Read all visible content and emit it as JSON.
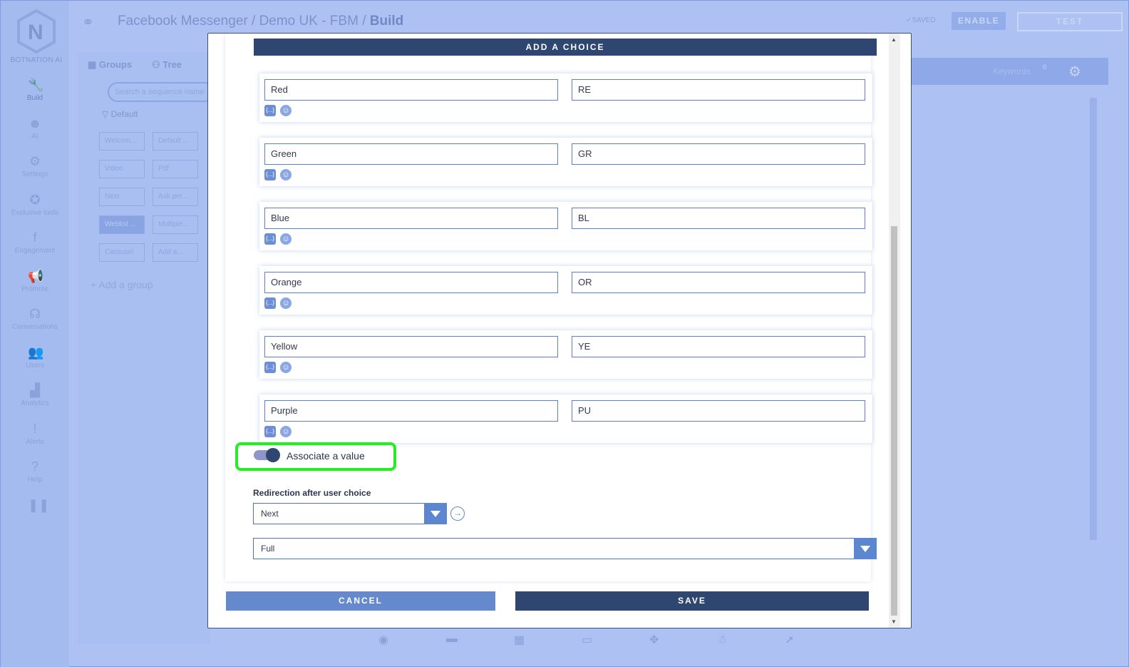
{
  "app": {
    "logo_text": "BOTNATION AI",
    "breadcrumb": [
      "Facebook Messenger",
      "Demo UK - FBM",
      "Build"
    ],
    "breadcrumb_sep": " / ",
    "saved": "SAVED",
    "enable_label": "ENABLE",
    "test_label": "TEST"
  },
  "sidebar": {
    "items": [
      {
        "label": "Build",
        "icon": "wrench-icon",
        "glyph": "🔧",
        "active": true
      },
      {
        "label": "AI",
        "icon": "robot-icon",
        "glyph": "☻"
      },
      {
        "label": "Settings",
        "icon": "gear-icon",
        "glyph": "⚙"
      },
      {
        "label": "Exclusive tools",
        "icon": "star-icon",
        "glyph": "✪"
      },
      {
        "label": "Engagement",
        "icon": "facebook-icon",
        "glyph": "f"
      },
      {
        "label": "Promote",
        "icon": "megaphone-icon",
        "glyph": "📢"
      },
      {
        "label": "Conversations",
        "icon": "headset-icon",
        "glyph": "☊"
      },
      {
        "label": "Users",
        "icon": "users-icon",
        "glyph": "👥"
      },
      {
        "label": "Analytics",
        "icon": "chart-icon",
        "glyph": "▟"
      },
      {
        "label": "Alerts",
        "icon": "alert-icon",
        "glyph": "!"
      },
      {
        "label": "Help",
        "icon": "help-icon",
        "glyph": "?"
      }
    ]
  },
  "panel": {
    "tabs": [
      "Groups",
      "Tree"
    ],
    "search_placeholder": "Search a sequence name",
    "group_name": "Default",
    "chips": [
      "Welcom...",
      "Default ...",
      "Video",
      "Pdf",
      "Next",
      "Ask pet ...",
      "Weblist ...",
      "Multiple...",
      "Carousel",
      "Add a..."
    ],
    "add_group": "Add a group"
  },
  "right": {
    "keywords": "Keywords",
    "keywords_count": "0"
  },
  "modal": {
    "add_choice": "ADD A CHOICE",
    "choices": [
      {
        "label": "Red",
        "value": "RE"
      },
      {
        "label": "Green",
        "value": "GR"
      },
      {
        "label": "Blue",
        "value": "BL"
      },
      {
        "label": "Orange",
        "value": "OR"
      },
      {
        "label": "Yellow",
        "value": "YE"
      },
      {
        "label": "Purple",
        "value": "PU"
      }
    ],
    "variable_glyph": "{...}",
    "emoji_glyph": "☺",
    "associate_label": "Associate a value",
    "associate_on": true,
    "redirection_label": "Redirection after user choice",
    "redirection_value": "Next",
    "size_value": "Full",
    "cancel_label": "CANCEL",
    "save_label": "SAVE"
  },
  "colors": {
    "primary": "#2f4670",
    "accent": "#5c86cf",
    "highlight": "#22ee22"
  }
}
